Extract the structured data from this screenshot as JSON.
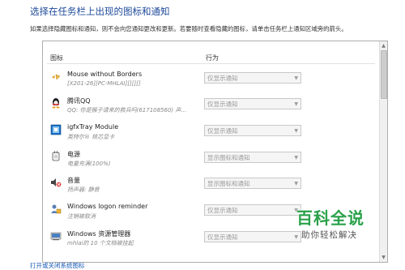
{
  "page": {
    "title": "选择在任务栏上出现的图标和通知",
    "description": "如果选择隐藏图标和通知，则不会向您通知更改和更新。若要随时查看隐藏的图标，请单击任务栏上通知区域旁的箭头。",
    "bottom_link": "打开或关闭系统图标"
  },
  "table": {
    "col_icon": "图标",
    "col_behavior": "行为",
    "rows": [
      {
        "name": "Mouse without Borders",
        "sub": "[X201-26][PC-MHLAI][][][]",
        "behavior": "仅显示通知",
        "icon": "mouse-without-borders-icon"
      },
      {
        "name": "腾讯QQ",
        "sub": "QQ: 你是猴子请来的救兵吗(617108560)  声...",
        "behavior": "仅显示通知",
        "icon": "qq-penguin-icon"
      },
      {
        "name": "igfxTray Module",
        "sub": "英特尔® 核芯显卡",
        "behavior": "仅显示通知",
        "icon": "intel-graphics-icon"
      },
      {
        "name": "电源",
        "sub": "电量充满(100%)",
        "behavior": "显示图标和通知",
        "icon": "power-plug-icon"
      },
      {
        "name": "音量",
        "sub": "扬声器: 静音",
        "behavior": "显示图标和通知",
        "icon": "speaker-muted-icon"
      },
      {
        "name": "Windows logon reminder",
        "sub": "注销被取消",
        "behavior": "仅显示通知",
        "icon": "logon-reminder-icon"
      },
      {
        "name": "Windows 资源管理器",
        "sub": "mhlai的 10 个文档被挂起",
        "behavior": "仅显示通知",
        "icon": "explorer-icon"
      }
    ]
  },
  "watermark": {
    "brand": "百科全说",
    "tagline": "助你轻松解决"
  }
}
